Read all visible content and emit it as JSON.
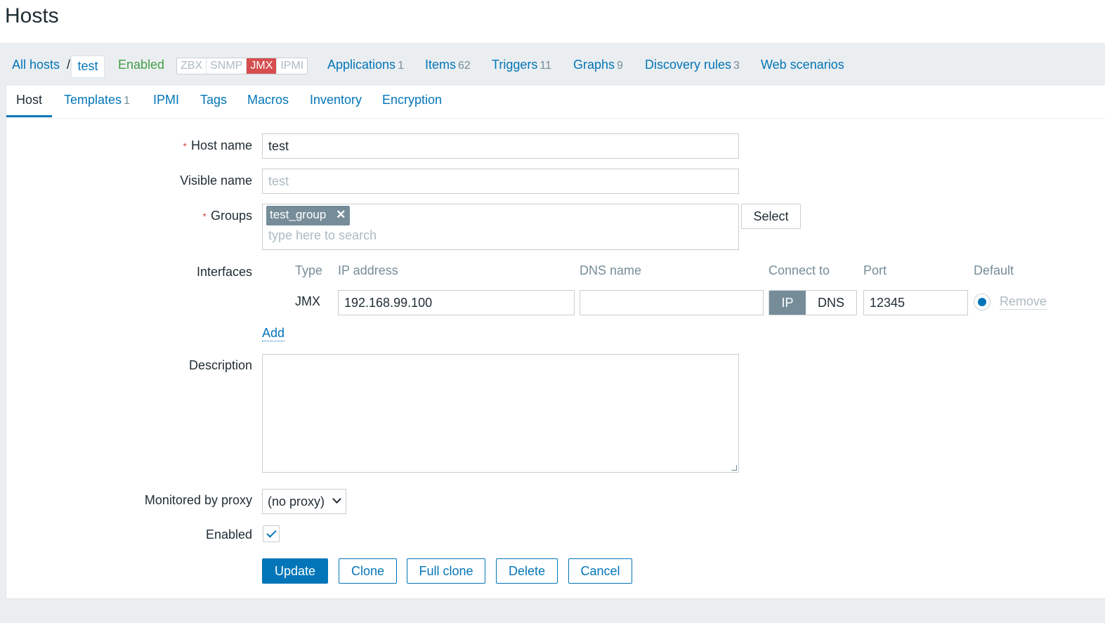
{
  "page": {
    "title": "Hosts"
  },
  "nav": {
    "all_hosts": "All hosts",
    "separator": "/",
    "current_host": "test",
    "status": "Enabled",
    "availability": [
      "ZBX",
      "SNMP",
      "JMX",
      "IPMI"
    ],
    "links": [
      {
        "label": "Applications",
        "count": "1"
      },
      {
        "label": "Items",
        "count": "62"
      },
      {
        "label": "Triggers",
        "count": "11"
      },
      {
        "label": "Graphs",
        "count": "9"
      },
      {
        "label": "Discovery rules",
        "count": "3"
      },
      {
        "label": "Web scenarios",
        "count": ""
      }
    ]
  },
  "tabs": {
    "host": "Host",
    "templates": "Templates",
    "templates_count": "1",
    "ipmi": "IPMI",
    "tags": "Tags",
    "macros": "Macros",
    "inventory": "Inventory",
    "encryption": "Encryption"
  },
  "form": {
    "host_name_label": "Host name",
    "host_name_value": "test",
    "visible_name_label": "Visible name",
    "visible_name_placeholder": "test",
    "groups_label": "Groups",
    "group_chip": "test_group",
    "groups_search_placeholder": "type here to search",
    "select_button": "Select",
    "interfaces_label": "Interfaces",
    "interfaces_headers": {
      "type": "Type",
      "ip": "IP address",
      "dns": "DNS name",
      "connect": "Connect to",
      "port": "Port",
      "default": "Default"
    },
    "interface": {
      "type": "JMX",
      "ip": "192.168.99.100",
      "dns": "",
      "connect_ip": "IP",
      "connect_dns": "DNS",
      "port": "12345",
      "remove": "Remove"
    },
    "add_link": "Add",
    "description_label": "Description",
    "description_value": "",
    "proxy_label": "Monitored by proxy",
    "proxy_value": "(no proxy)",
    "enabled_label": "Enabled",
    "enabled_checked": true
  },
  "buttons": {
    "update": "Update",
    "clone": "Clone",
    "full_clone": "Full clone",
    "delete": "Delete",
    "cancel": "Cancel"
  },
  "colors": {
    "accent": "#0275b8",
    "enabled": "#429e47",
    "jmx_active": "#d64e4e",
    "required": "#d64e4e"
  }
}
